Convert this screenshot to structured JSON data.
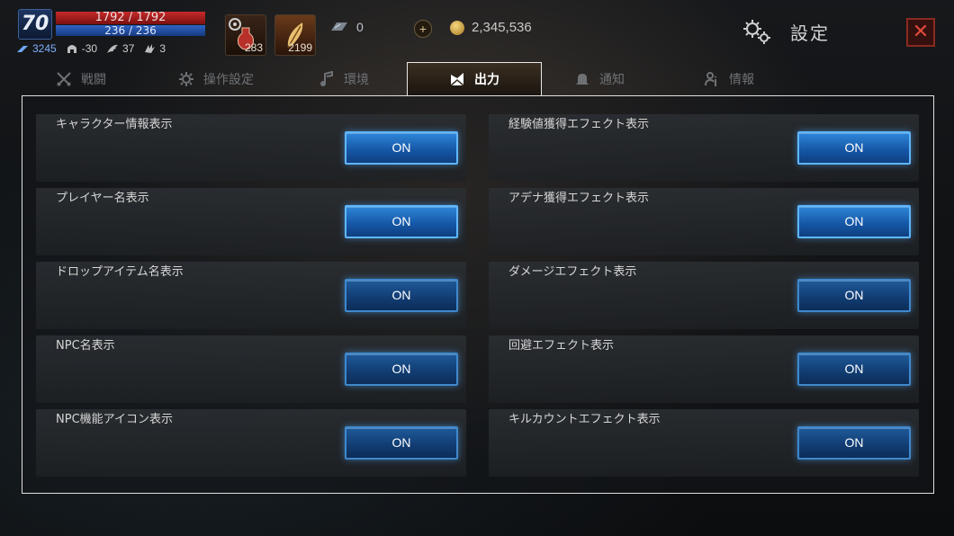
{
  "hud": {
    "level": "70",
    "hp": "1792 / 1792",
    "mp": "236 / 236",
    "stats": [
      {
        "icon": "speed-icon",
        "value": "3245"
      },
      {
        "icon": "helmet-icon",
        "value": "-30"
      },
      {
        "icon": "wing-icon",
        "value": "37"
      },
      {
        "icon": "claw-icon",
        "value": "3"
      }
    ],
    "potion_count": "283",
    "feather_count": "2199",
    "gem_count": "0",
    "plus_label": "+",
    "gold": "2,345,536",
    "title": "設定",
    "close_label": "✕"
  },
  "tabs": [
    {
      "label": "戦闘",
      "icon": "swords-icon"
    },
    {
      "label": "操作設定",
      "icon": "gear-icon"
    },
    {
      "label": "環境",
      "icon": "music-note-icon"
    },
    {
      "label": "出力",
      "icon": "output-icon",
      "active": true
    },
    {
      "label": "通知",
      "icon": "bell-icon"
    },
    {
      "label": "情報",
      "icon": "user-info-icon"
    }
  ],
  "settings": {
    "left": [
      {
        "label": "キャラクター情報表示",
        "value": "ON"
      },
      {
        "label": "プレイヤー名表示",
        "value": "ON"
      },
      {
        "label": "ドロップアイテム名表示",
        "value": "ON"
      },
      {
        "label": "NPC名表示",
        "value": "ON"
      },
      {
        "label": "NPC機能アイコン表示",
        "value": "ON"
      }
    ],
    "right": [
      {
        "label": "経験値獲得エフェクト表示",
        "value": "ON"
      },
      {
        "label": "アデナ獲得エフェクト表示",
        "value": "ON"
      },
      {
        "label": "ダメージエフェクト表示",
        "value": "ON"
      },
      {
        "label": "回避エフェクト表示",
        "value": "ON"
      },
      {
        "label": "キルカウントエフェクト表示",
        "value": "ON"
      }
    ]
  },
  "colors": {
    "toggle_on": "#1f6fc4",
    "toggle_border": "#5fb6ff",
    "hp": "#c72a2a",
    "mp": "#2f63c4",
    "close": "#e04a38"
  }
}
